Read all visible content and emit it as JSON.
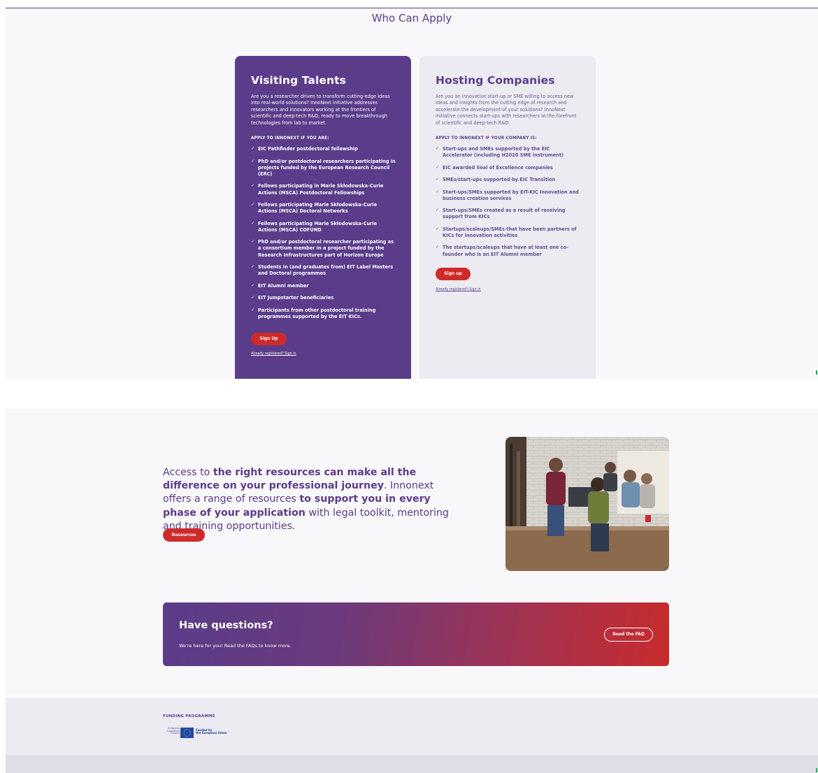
{
  "section_title": "Who Can Apply",
  "talents": {
    "title": "Visiting Talents",
    "intro": "Are you a researcher driven to transform cutting-edge ideas into real-world solutions? InnoNext initiative addresses researchers and innovators working at the frontiers of scientific and deep-tech R&D, ready to move breakthrough technologies from lab to market.",
    "apply_label": "APPLY TO INNONEXT IF YOU ARE:",
    "items": [
      "EIC Pathfinder postdoctoral fellowship",
      "PhD and/or postdoctoral researchers participating in projects funded by the European Research Council (ERC)",
      "Fellows participating in Marie Skłodowska-Curie Actions (MSCA) Postdoctoral Fellowships",
      "Fellows participating Marie Skłodowska-Curie Actions (MSCA) Doctoral Networks",
      "Fellows participating Marie Skłodowska-Curie Actions (MSCA) COFUND",
      "PhD and/or postdoctoral researcher participating as a consortium member in a project funded by the Research Infrastructures part of Horizon Europe",
      "Students in (and graduates from) EIT Label Masters and Doctoral programmes",
      "EIT Alumni member",
      "EIT Jumpstarter beneficiaries",
      "Participants from other postdoctoral training programmes supported by the EIT KICs."
    ],
    "signup_label": "Sign Up",
    "signin_label": "Already registered? Sign in"
  },
  "hosting": {
    "title": "Hosting Companies",
    "intro": "Are you an innovative start-up or SME willing to access new ideas and insights from the cutting edge of research and accelerate the development of your solutions? InnoNext initiative connects start-ups with researchers at the forefront of scientific and deep-tech R&D.",
    "apply_label": "APPLY TO INNONEXT IF YOUR COMPANY IS:",
    "items": [
      "Start-ups and SMEs supported by the EIC Accelerator (including H2020 SME instrument)",
      "EIC awarded Seal of Excellence companies",
      "SMEs/start-ups supported by EIC Transition",
      "Start-ups/SMEs supported by EIT-KIC Innovation and business creation services",
      "Start-ups/SMEs created as a result of receiving support from KICs",
      "Startups/scaleups/SMEs that have been partners of KICs for innovation activities",
      "The startups/scaleups that have at least one co-founder who is an EIT Alumni member"
    ],
    "signup_label": "Sign up",
    "signin_label": "Already registered? Sign in"
  },
  "promo": {
    "p1": "Access to ",
    "p2": "the right resources can make all the difference on your professional journey",
    "p3": ". Innonext offers a range of resources ",
    "p4": "to support you in every phase of your application",
    "p5": " with legal toolkit, mentoring and training opportunities.",
    "button": "Resources"
  },
  "faq": {
    "title": "Have questions?",
    "subtitle": "We're here for you! Read the FAQs to know more.",
    "button": "Read the FAQ"
  },
  "footer": {
    "label": "FUNDING PROGRAMME",
    "eic_text": "European Innovation Council",
    "eu_text_1": "Funded by",
    "eu_text_2": "the European Union"
  },
  "colors": {
    "brand_purple": "#5a3c8a",
    "accent_red": "#cf2a2a",
    "light_card": "#ecebf2"
  }
}
